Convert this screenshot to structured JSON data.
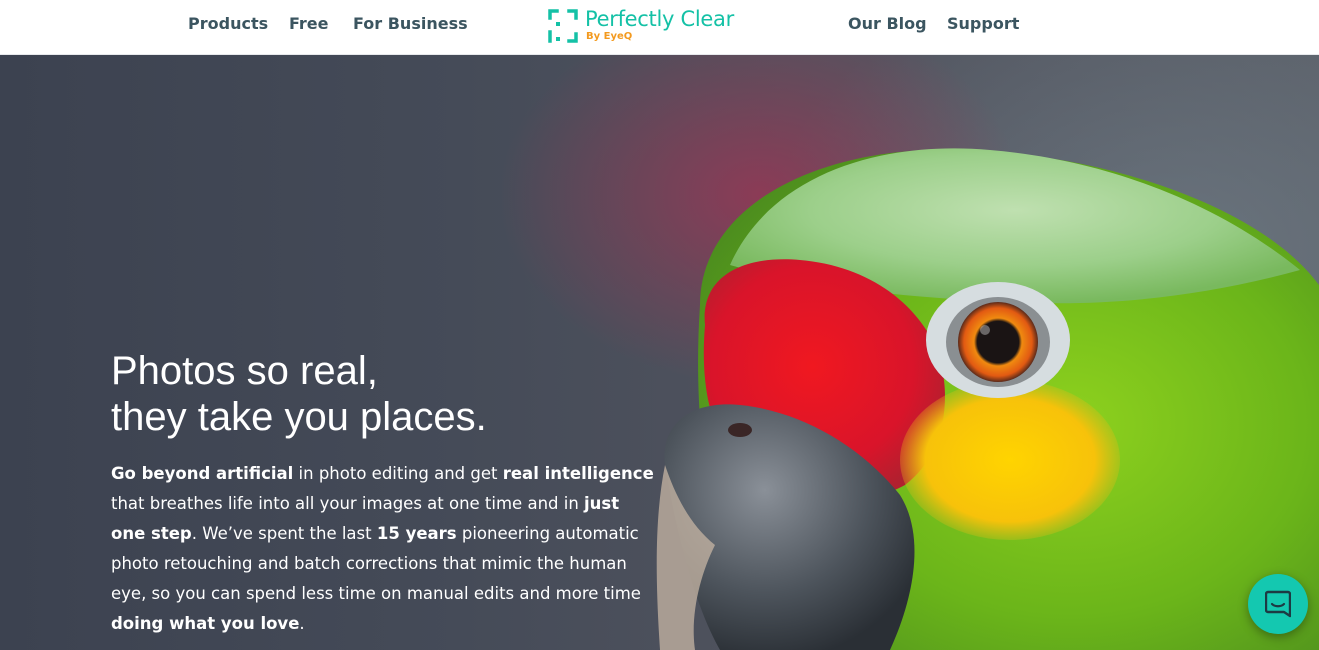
{
  "nav": {
    "left_links": [
      {
        "label": "Products"
      },
      {
        "label": "Free"
      },
      {
        "label": "For Business"
      }
    ],
    "right_links": [
      {
        "label": "Our Blog"
      },
      {
        "label": "Support"
      }
    ],
    "logo": {
      "name": "Perfectly Clear",
      "sub": "By EyeQ"
    }
  },
  "hero": {
    "headline": [
      "Photos so real,",
      "they take you places."
    ],
    "body": [
      {
        "text": "Go beyond artificial",
        "bold": true
      },
      {
        "text": " in photo editing and get ",
        "bold": false
      },
      {
        "text": "real intelligence",
        "bold": true
      },
      {
        "text": " that breathes life into all your images at one time and in ",
        "bold": false
      },
      {
        "text": "just one step",
        "bold": true
      },
      {
        "text": ". We’ve spent the last ",
        "bold": false
      },
      {
        "text": "15 years",
        "bold": true
      },
      {
        "text": " pioneering automatic photo retouching and batch corrections that mimic the human eye, so you can spend less time on manual edits and more time ",
        "bold": false
      },
      {
        "text": "doing what you love",
        "bold": true
      },
      {
        "text": ".",
        "bold": false
      }
    ],
    "image_subject": "parrot-photo"
  },
  "chat": {
    "icon": "chat-icon"
  },
  "colors": {
    "brand_teal": "#14c1a6",
    "brand_orange": "#f39a1f",
    "nav_text": "#3b5560",
    "hero_text": "#ffffff",
    "chat_bg": "#14c8b0"
  }
}
